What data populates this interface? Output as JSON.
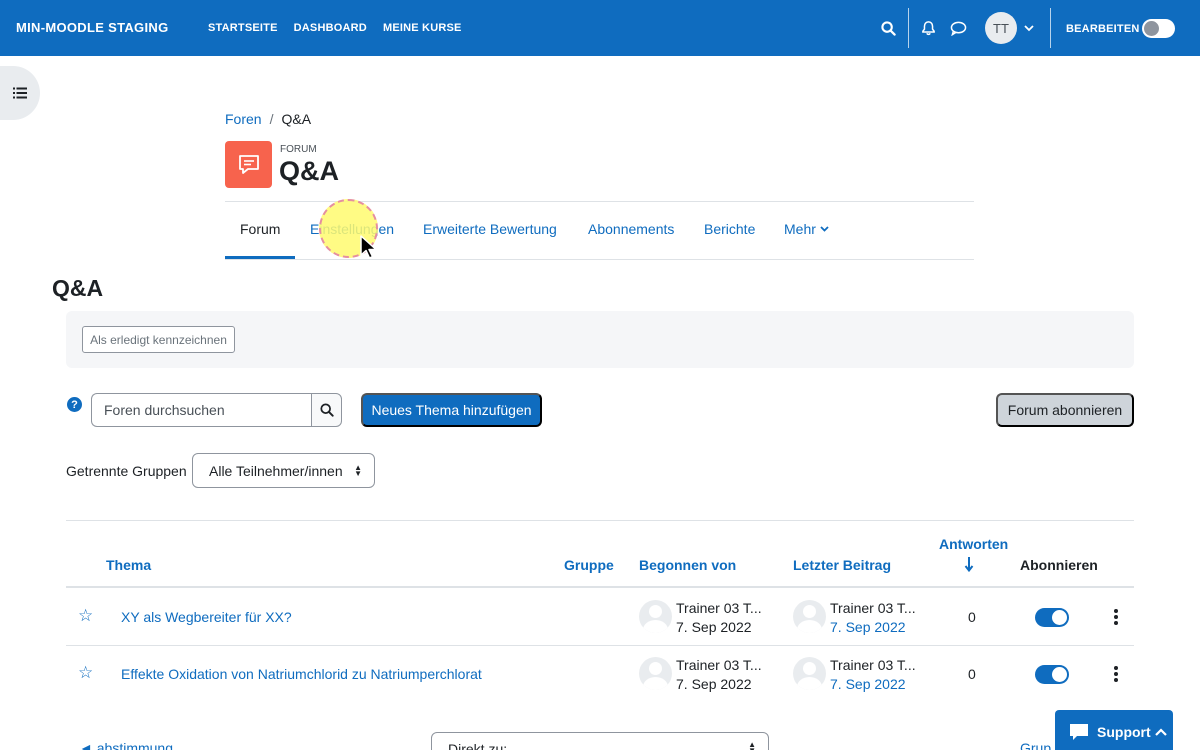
{
  "navbar": {
    "brand": "MIN-MOODLE STAGING",
    "links": [
      "STARTSEITE",
      "DASHBOARD",
      "MEINE KURSE"
    ],
    "avatar_initials": "TT",
    "edit_mode_label": "BEARBEITEN",
    "edit_mode_on": false,
    "bg_color": "#0f6cbf"
  },
  "breadcrumb": {
    "items": [
      "Foren",
      "Q&A"
    ],
    "separator": "/"
  },
  "activity": {
    "type_label": "FORUM",
    "title": "Q&A",
    "icon": "forum-icon",
    "icon_color": "#f7634d"
  },
  "secondary_nav": {
    "tabs": [
      "Forum",
      "Einstellungen",
      "Erweiterte Bewertung",
      "Abonnements",
      "Berichte",
      "Mehr"
    ],
    "active_index": 0
  },
  "page": {
    "heading": "Q&A",
    "mark_done_label": "Als erledigt kennzeichnen",
    "search_placeholder": "Foren durchsuchen",
    "add_topic_label": "Neues Thema hinzufügen",
    "subscribe_label": "Forum abonnieren",
    "groups_label": "Getrennte Gruppen",
    "groups_selected": "Alle Teilnehmer/innen"
  },
  "table": {
    "headers": {
      "topic": "Thema",
      "group": "Gruppe",
      "started_by": "Begonnen von",
      "last_post": "Letzter Beitrag",
      "replies": "Antworten",
      "subscribe": "Abonnieren"
    },
    "rows": [
      {
        "topic": "XY als Wegbereiter für XX?",
        "started_name": "Trainer 03 T...",
        "started_date": "7. Sep 2022",
        "last_name": "Trainer 03 T...",
        "last_date": "7. Sep 2022",
        "replies": "0",
        "subscribed": true
      },
      {
        "topic": "Effekte Oxidation von Natriumchlorid zu Natriumperchlorat",
        "started_name": "Trainer 03 T...",
        "started_date": "7. Sep 2022",
        "last_name": "Trainer 03 T...",
        "last_date": "7. Sep 2022",
        "replies": "0",
        "subscribed": true
      }
    ]
  },
  "footer": {
    "prev_link": "◄ abstimmung",
    "jump_to": "Direkt zu:",
    "next_link": "Grup",
    "support_label": "Support"
  }
}
